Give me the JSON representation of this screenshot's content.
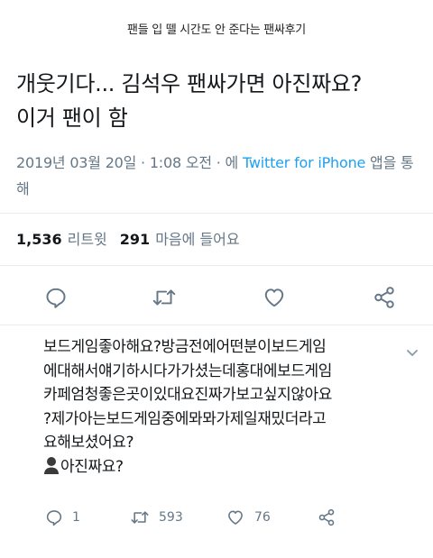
{
  "caption": "팬들 입 뗄 시간도 안 준다는 팬싸후기",
  "tweet": {
    "lines": [
      "개웃기다... 김석우 팬싸가면 아진짜요?",
      "이거 팬이 함"
    ],
    "timestamp": "2019년 03월 20일 · 1:08 오전 · 에 ",
    "source_link": "Twitter for iPhone",
    "source_suffix": " 앱을 통해"
  },
  "stats": {
    "retweets_count": "1,536",
    "retweets_label": "리트윗",
    "likes_count": "291",
    "likes_label": "마음에 들어요"
  },
  "actions": [
    "reply-icon",
    "retweet-icon",
    "like-icon",
    "share-icon"
  ],
  "reply": {
    "lines": [
      "보드게임좋아해요?방금전에어떤분이보드게임",
      "에대해서얘기하시다가가셨는데홍대에보드게임",
      "카페엄청좋은곳이있대요진짜가보고싶지않아요",
      "?제가아는보드게임중에뫄뫄가제일재밌더라고",
      "요해보셨어요?"
    ],
    "last_line": "아진짜요?",
    "reply_count": "1",
    "retweet_count": "593",
    "like_count": "76"
  },
  "colors": {
    "accent": "#1da1f2",
    "muted": "#657786",
    "text": "#14171a",
    "divider": "#e6ecf0"
  }
}
